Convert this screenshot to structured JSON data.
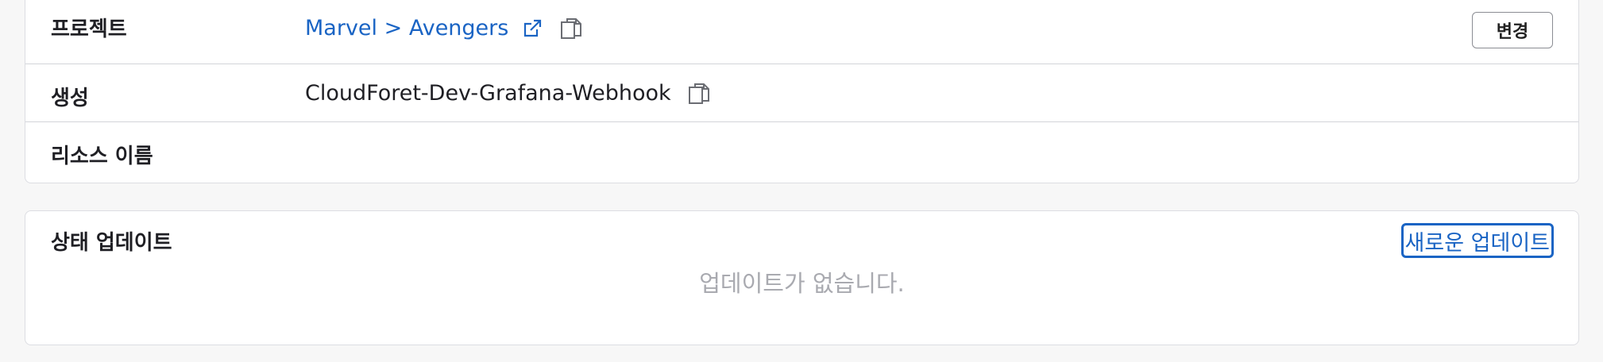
{
  "details": {
    "project": {
      "label": "프로젝트",
      "value": "Marvel > Avengers",
      "external_link_icon": "external-link-icon",
      "copy_icon": "copy-icon",
      "change_button": "변경"
    },
    "created_by": {
      "label": "생성",
      "value": "CloudForet-Dev-Grafana-Webhook",
      "copy_icon": "copy-icon"
    },
    "resource_name": {
      "label": "리소스 이름",
      "value": ""
    }
  },
  "status_update": {
    "title": "상태 업데이트",
    "new_button": "새로운 업데이트",
    "empty_text": "업데이트가 없습니다."
  },
  "colors": {
    "link": "#1a64c4",
    "border": "#d3d4d9",
    "muted_text": "#a9aab0",
    "background": "#f7f7f7"
  }
}
